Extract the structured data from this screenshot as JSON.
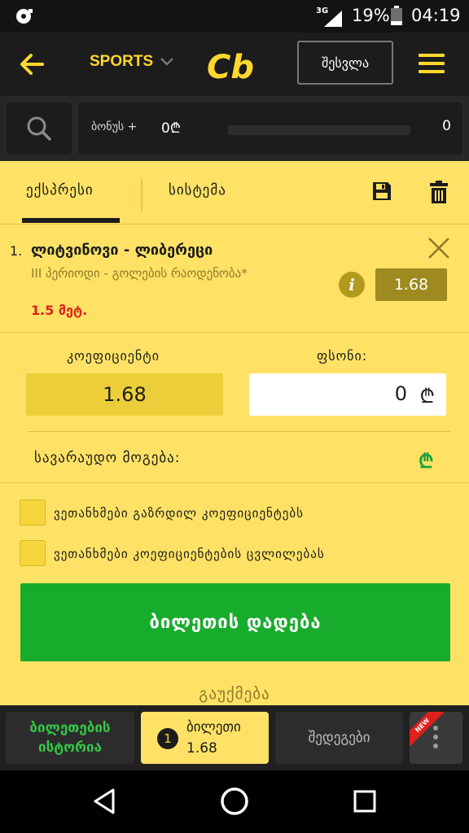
{
  "status_bar": {
    "network": "3G",
    "battery": "19%",
    "time": "04:19"
  },
  "header": {
    "sports_label": "SPORTS",
    "login_label": "შესვლა"
  },
  "bonus": {
    "label": "ბონუს +",
    "value": "0₾",
    "count": "0",
    "progress": 0
  },
  "tabs": [
    {
      "label": "ექსპრესი",
      "active": true
    },
    {
      "label": "სისტემა",
      "active": false
    }
  ],
  "bet": {
    "number": "1.",
    "event": "ლიტვინოვი - ლიბერეცი",
    "market": "III პერიოდი - გოლების რაოდენობა*",
    "line": "1.5 მეტ.",
    "odd": "1.68"
  },
  "coefficient": {
    "label": "კოეფიციენტი",
    "value": "1.68"
  },
  "stake": {
    "label": "ფსონი:",
    "value": "0",
    "currency": "₾"
  },
  "possible_win": {
    "label": "სავარაუდო მოგება:",
    "currency": "₾"
  },
  "options": [
    {
      "label": "ვეთანხმები გაზრდილ კოეფიციენტებს",
      "checked": false
    },
    {
      "label": "ვეთანხმები კოეფიციენტების ცვლილებას",
      "checked": false
    }
  ],
  "place_bet_label": "ბილეთის დადება",
  "cancel_label": "გაუქმება",
  "bottom_tabs": {
    "history_line1": "ბილეთების",
    "history_line2": "ისტორია",
    "ticket_count": "1",
    "ticket_label": "ბილეთი",
    "ticket_odd": "1.68",
    "results_label": "შედეგები",
    "new_badge": "NEW"
  },
  "colors": {
    "accent": "#ffd82e",
    "background": "#ffe265",
    "success": "#18ac2c",
    "danger": "#e0201b",
    "header": "#1c1c1c"
  }
}
